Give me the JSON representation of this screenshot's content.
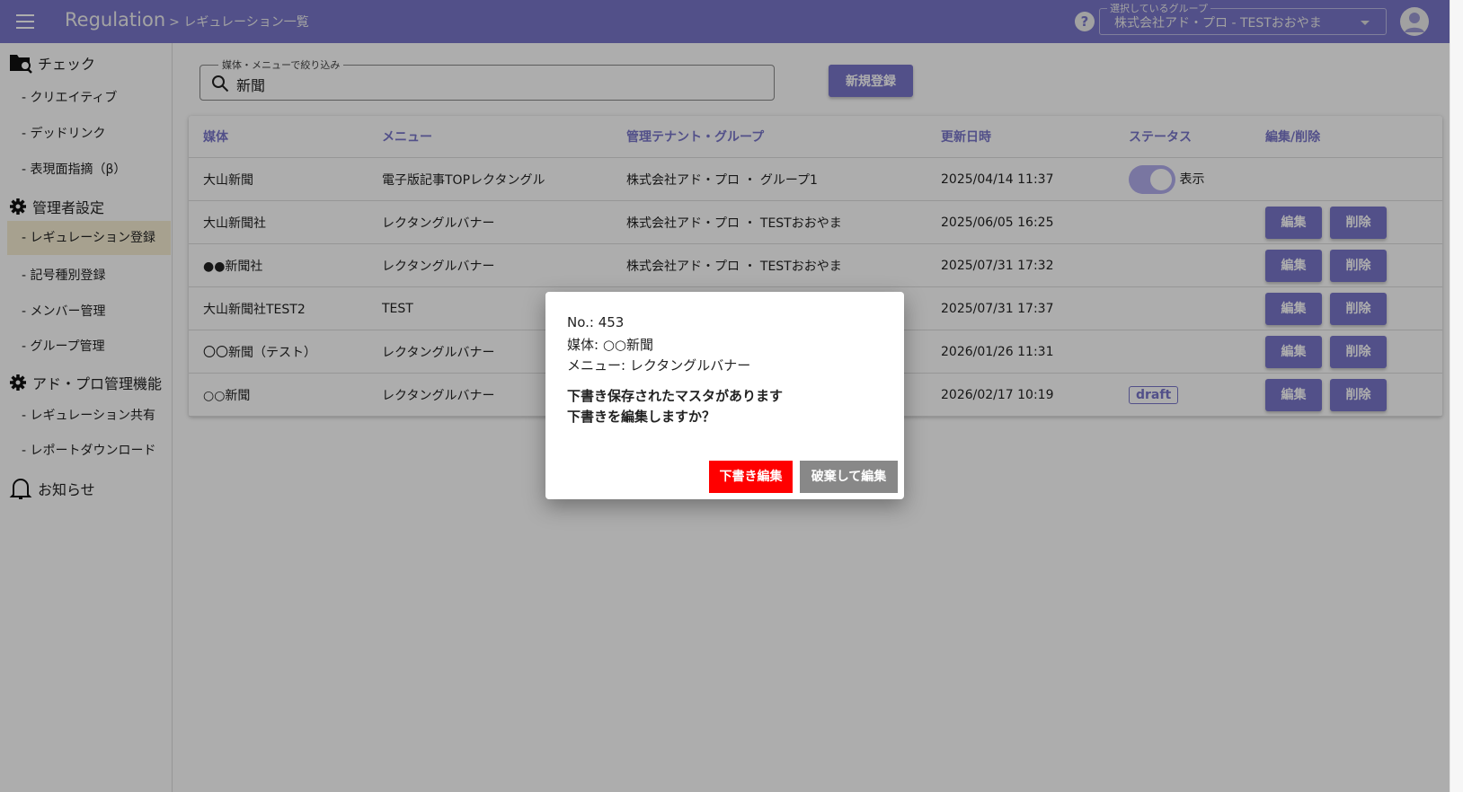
{
  "header": {
    "title": "Regulation",
    "breadcrumb": "> レギュレーション一覧",
    "group_label": "選択しているグループ",
    "group_value": "株式会社アド・プロ - TESTおおやま",
    "help": "?"
  },
  "sidebar": {
    "check": "チェック",
    "creative": "- クリエイティブ",
    "deadlink": "- デッドリンク",
    "expression": "- 表現面指摘（β）",
    "admin": "管理者設定",
    "reg": "- レギュレーション登録",
    "symbol": "- 記号種別登録",
    "member": "- メンバー管理",
    "group": "- グループ管理",
    "adpro": "アド・プロ管理機能",
    "share": "- レギュレーション共有",
    "report": "- レポートダウンロード",
    "notice": "お知らせ"
  },
  "search": {
    "label": "媒体・メニューで絞り込み",
    "value": "新聞"
  },
  "new_button": "新規登録",
  "table": {
    "headers": [
      "媒体",
      "メニュー",
      "管理テナント・グループ",
      "更新日時",
      "ステータス",
      "編集/削除"
    ],
    "rows": [
      {
        "media": "大山新聞",
        "menu": "電子版記事TOPレクタングル",
        "tenant": "株式会社アド・プロ ・ グループ1",
        "updated": "2025/04/14 11:37",
        "status": "表示"
      },
      {
        "media": "大山新聞社",
        "menu": "レクタングルバナー",
        "tenant": "株式会社アド・プロ ・ TESTおおやま",
        "updated": "2025/06/05 16:25"
      },
      {
        "media": "●●新聞社",
        "menu": "レクタングルバナー",
        "tenant": "株式会社アド・プロ ・ TESTおおやま",
        "updated": "2025/07/31 17:32"
      },
      {
        "media": "大山新聞社TEST2",
        "menu": "TEST",
        "tenant": "",
        "updated": "2025/07/31 17:37"
      },
      {
        "media": "〇〇新聞（テスト）",
        "menu": "レクタングルバナー",
        "tenant": "",
        "updated": "2026/01/26 11:31"
      },
      {
        "media": "○○新聞",
        "menu": "レクタングルバナー",
        "tenant": "",
        "updated": "2026/02/17 10:19",
        "status": "draft"
      }
    ],
    "edit": "編集",
    "delete": "削除"
  },
  "dialog": {
    "no": "No.: 453",
    "media": "媒体: ○○新聞",
    "menu": "メニュー: レクタングルバナー",
    "msg1": "下書き保存されたマスタがあります",
    "msg2": "下書きを編集しますか？",
    "draft_edit": "下書き編集",
    "discard_edit": "破棄して編集"
  },
  "colors": {
    "accent": "#7a76cb",
    "danger": "#ff0000",
    "secondary": "#888888"
  }
}
